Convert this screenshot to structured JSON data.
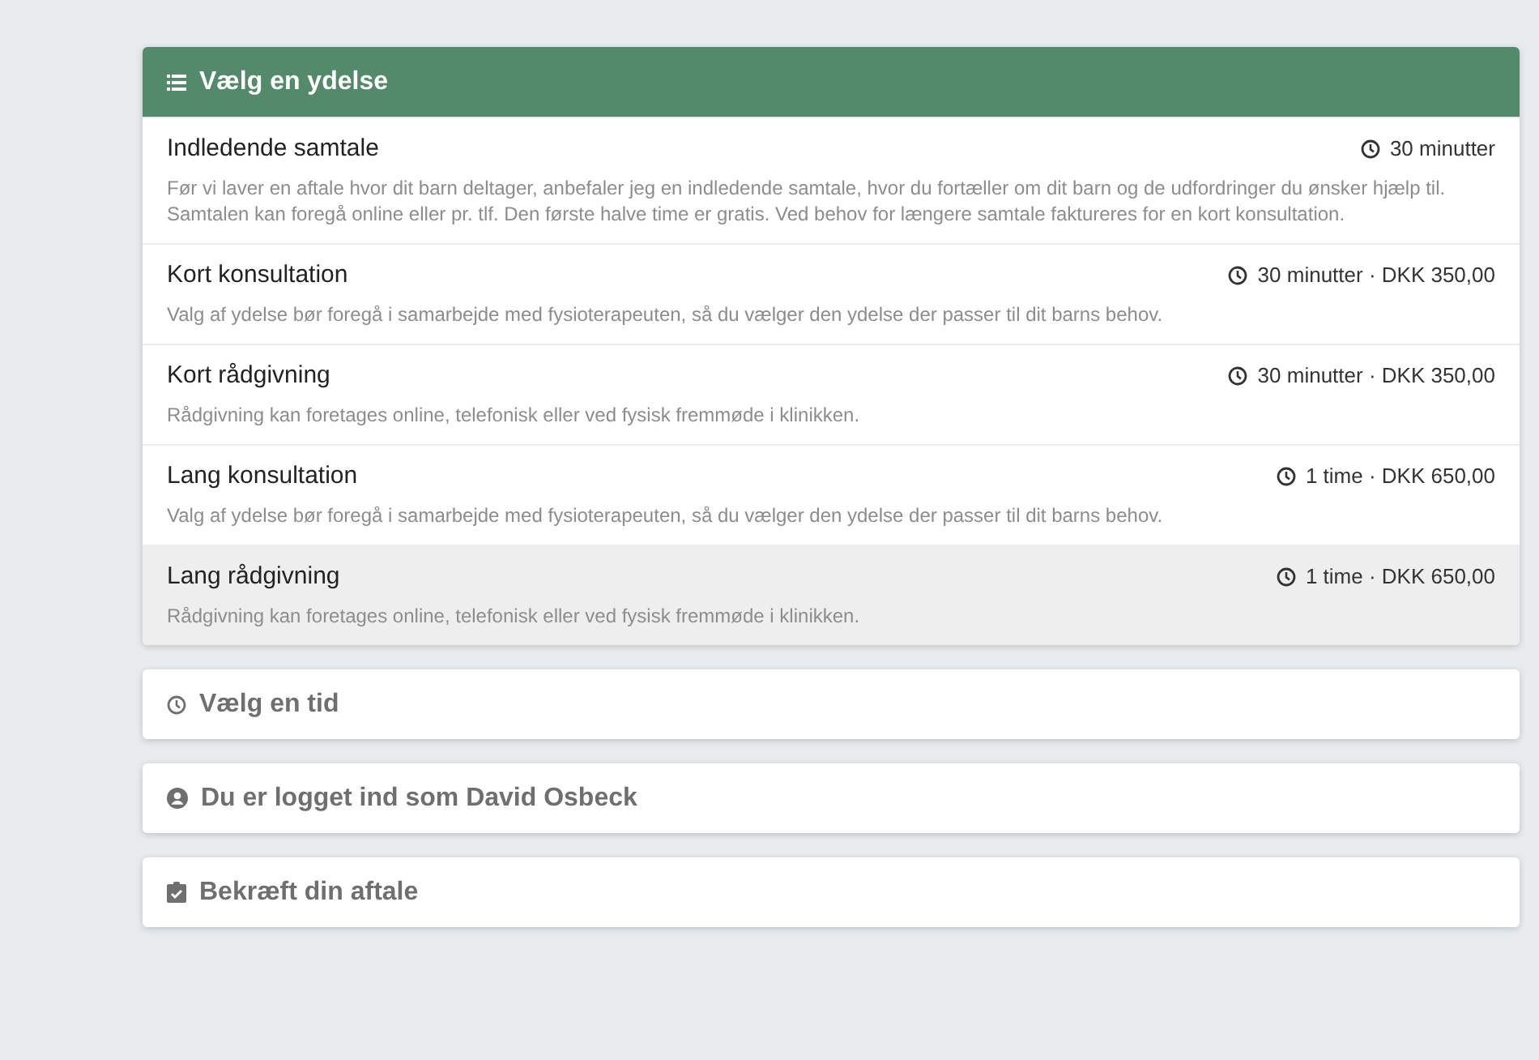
{
  "sections": [
    {
      "title": "Vælg en ydelse",
      "kind": "services",
      "expanded": true,
      "services": [
        {
          "name": "Indledende samtale",
          "meta": "30 minutter",
          "description": "Før vi laver en aftale hvor dit barn deltager, anbefaler jeg en indledende samtale, hvor du fortæller om dit barn og de udfordringer du ønsker hjælp til. Samtalen kan foregå online eller pr. tlf. Den første halve time er gratis. Ved behov for længere samtale faktureres for en kort konsultation.",
          "highlighted": false
        },
        {
          "name": "Kort konsultation",
          "meta": "30 minutter · DKK 350,00",
          "description": "Valg af ydelse bør foregå i samarbejde med fysioterapeuten, så du vælger den ydelse der passer til dit barns behov.",
          "highlighted": false
        },
        {
          "name": "Kort rådgivning",
          "meta": "30 minutter · DKK 350,00",
          "description": "Rådgivning kan foretages online, telefonisk eller ved fysisk fremmøde i klinikken.",
          "highlighted": false
        },
        {
          "name": "Lang konsultation",
          "meta": "1 time · DKK 650,00",
          "description": "Valg af ydelse bør foregå i samarbejde med fysioterapeuten, så du vælger den ydelse der passer til dit barns behov.",
          "highlighted": false
        },
        {
          "name": "Lang rådgivning",
          "meta": "1 time · DKK 650,00",
          "description": "Rådgivning kan foretages online, telefonisk eller ved fysisk fremmøde i klinikken.",
          "highlighted": true
        }
      ]
    },
    {
      "title": "Vælg en tid",
      "kind": "time",
      "expanded": false
    },
    {
      "title": "Du er logget ind som David Osbeck",
      "kind": "login",
      "expanded": false
    },
    {
      "title": "Bekræft din aftale",
      "kind": "confirm",
      "expanded": false
    }
  ]
}
